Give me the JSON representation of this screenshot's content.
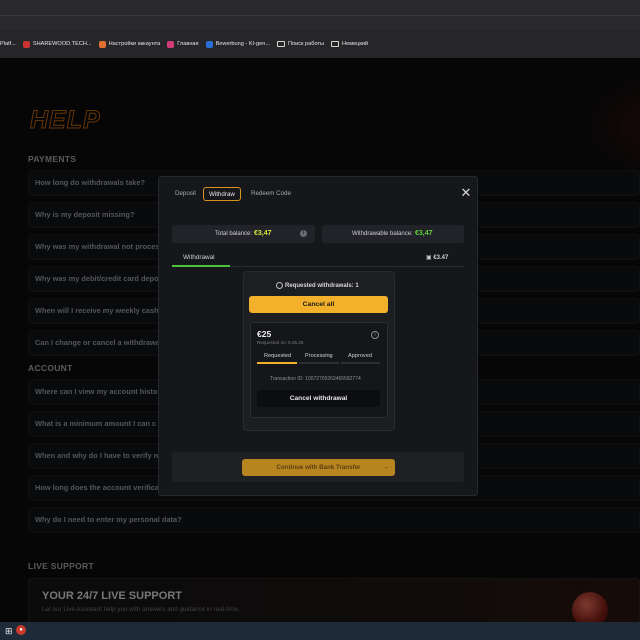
{
  "browser": {
    "bookmarks": [
      {
        "label": "Platf...",
        "color": "#d6d6d6",
        "icon": "folder-icon"
      },
      {
        "label": "SHAREWOOD.TECH...",
        "color": "#cc3333",
        "icon": "site-icon"
      },
      {
        "label": "Настройки аккаунта",
        "color": "#e07030",
        "icon": "site-icon"
      },
      {
        "label": "Главная",
        "color": "#d23c7a",
        "icon": "site-icon"
      },
      {
        "label": "Bewerbung - KI-gen...",
        "color": "#2a6fd6",
        "icon": "site-icon"
      },
      {
        "label": "Поиск работы",
        "color": "#d6d6d6",
        "icon": "folder-icon"
      },
      {
        "label": "Немецкий",
        "color": "#d6d6d6",
        "icon": "folder-icon"
      }
    ]
  },
  "page": {
    "title": "HELP",
    "sections": {
      "payments": "PAYMENTS",
      "account": "ACCOUNT",
      "live_support": "LIVE SUPPORT"
    },
    "payments_faq": [
      "How long do withdrawals take?",
      "Why is my deposit missing?",
      "Why was my withdrawal not proces",
      "Why was my debit/credit card depo",
      "When will I receive my weekly cash",
      "Can I change or cancel a withdrawa"
    ],
    "account_faq": [
      "Where can I view my account histo",
      "What is a minimum amount  I can c",
      "When and why do I have to verify n",
      "How long does the account verifica",
      "Why do I need to enter my personal data?"
    ],
    "live_support": {
      "title": "YOUR 24/7 LIVE SUPPORT",
      "text": "Let our Live Assistant help you with answers and guidance in real-time,"
    }
  },
  "modal": {
    "tabs": [
      "Deposit",
      "Withdraw",
      "Redeem Code"
    ],
    "active_tab": "Withdraw",
    "close_icon": "close-icon",
    "total_balance_label": "Total balance:",
    "total_balance_value": "€3,47",
    "withdrawable_label": "Withdrawable balance:",
    "withdrawable_value": "€3,47",
    "withdrawal_tab": "Withdrawal",
    "withdrawal_amount": "€3.47",
    "requested_title": "Requested withdrawals: 1",
    "cancel_all": "Cancel all",
    "request": {
      "amount": "€25",
      "date": "Requested on: 8.05.25",
      "steps": [
        "Requested",
        "Processing",
        "Approved"
      ],
      "progress_step": 1,
      "transaction": "Transaction ID: 10072700263465582774",
      "cancel": "Cancel withdrawal"
    },
    "continue_button": "Continue with Bank Transfer"
  },
  "colors": {
    "accent": "#f2b02b",
    "balance_yellow": "#d7e63c",
    "balance_green": "#5fd23a",
    "help_title_outline": "#b8610f"
  }
}
